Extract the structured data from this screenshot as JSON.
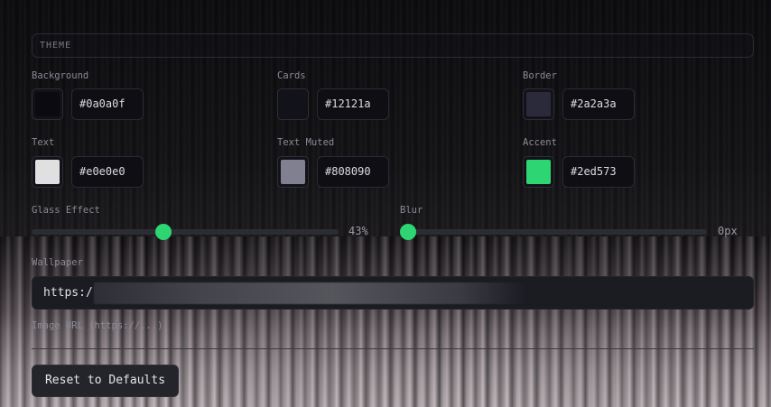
{
  "section": {
    "title": "THEME"
  },
  "colors": [
    {
      "label": "Background",
      "hex": "#0a0a0f"
    },
    {
      "label": "Cards",
      "hex": "#12121a"
    },
    {
      "label": "Border",
      "hex": "#2a2a3a"
    },
    {
      "label": "Text",
      "hex": "#e0e0e0"
    },
    {
      "label": "Text Muted",
      "hex": "#808090"
    },
    {
      "label": "Accent",
      "hex": "#2ed573"
    }
  ],
  "sliders": {
    "glass": {
      "label": "Glass Effect",
      "value_text": "43%",
      "value": 0.43
    },
    "blur": {
      "label": "Blur",
      "value_text": "0px",
      "value": 0.0
    }
  },
  "wallpaper": {
    "label": "Wallpaper",
    "value": "https:/",
    "hint": "Image URL (https://...)"
  },
  "reset_label": "Reset to Defaults"
}
